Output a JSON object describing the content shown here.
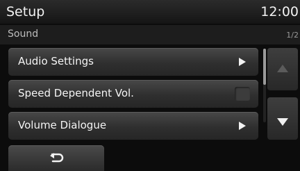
{
  "header": {
    "title": "Setup",
    "time": "12:00"
  },
  "subheader": {
    "section": "Sound",
    "page_indicator": "1/2"
  },
  "menu": {
    "items": [
      {
        "label": "Audio Settings",
        "control": "arrow-right"
      },
      {
        "label": "Speed Dependent Vol.",
        "control": "checkbox",
        "checked": false
      },
      {
        "label": "Volume Dialogue",
        "control": "arrow-right"
      }
    ]
  },
  "scroll": {
    "up_icon": "triangle-up-icon",
    "down_icon": "triangle-down-icon",
    "up_enabled": false,
    "down_enabled": true
  },
  "footer": {
    "back_icon": "back-arrow-icon"
  },
  "colors": {
    "background": "#0c0c0c",
    "button": "#3a3a3a",
    "text": "#f4f4f4",
    "disabled": "#5b5b5b"
  }
}
